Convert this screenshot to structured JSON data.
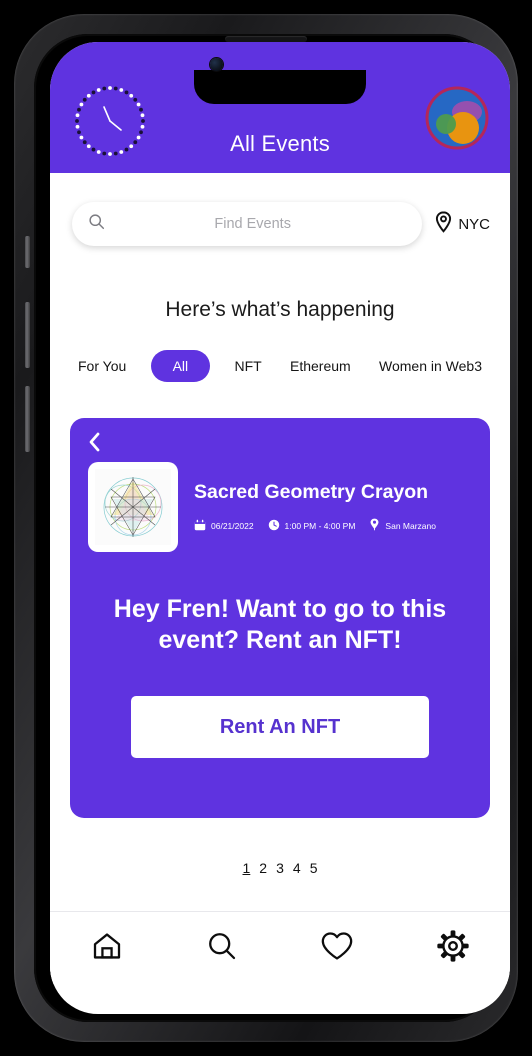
{
  "device": {
    "name": "smartphone-mockup"
  },
  "header": {
    "title": "All Events",
    "clock_icon": "dotted-clock-icon",
    "avatar_icon": "profile-avatar"
  },
  "search": {
    "placeholder": "Find Events",
    "value": "",
    "icon": "search-icon",
    "location_icon": "location-pin-icon",
    "location_label": "NYC"
  },
  "section": {
    "heading": "Here’s what’s happening"
  },
  "filters": {
    "chips": [
      {
        "label": "For You",
        "active": false
      },
      {
        "label": "All",
        "active": true
      },
      {
        "label": "NFT",
        "active": false
      },
      {
        "label": "Ethereum",
        "active": false
      },
      {
        "label": "Women in Web3",
        "active": false
      }
    ]
  },
  "event_card": {
    "back_icon": "chevron-left-icon",
    "thumbnail_icon": "sacred-geometry-artwork",
    "title": "Sacred Geometry Crayon",
    "meta": [
      {
        "icon": "calendar-icon",
        "text": "06/21/2022"
      },
      {
        "icon": "clock-icon",
        "text": "1:00 PM - 4:00 PM"
      },
      {
        "icon": "map-pin-icon",
        "text": "San Marzano"
      }
    ],
    "cta_line1": "Hey Fren! Want to go to this",
    "cta_line2": "event? Rent an NFT!",
    "cta_button": "Rent An NFT"
  },
  "pagination": {
    "pages": [
      "1",
      "2",
      "3",
      "4",
      "5"
    ],
    "current": "1"
  },
  "bottom_nav": {
    "items": [
      {
        "icon": "home-icon",
        "label": "Home"
      },
      {
        "icon": "search-icon",
        "label": "Search"
      },
      {
        "icon": "heart-icon",
        "label": "Favorites"
      },
      {
        "icon": "gear-icon",
        "label": "Settings"
      }
    ]
  },
  "colors": {
    "brand_purple": "#5F33E0",
    "card_purple": "#5B36DC",
    "button_text": "#5632CF",
    "background": "#FFFFFF",
    "frame": "#1A1A1C"
  }
}
